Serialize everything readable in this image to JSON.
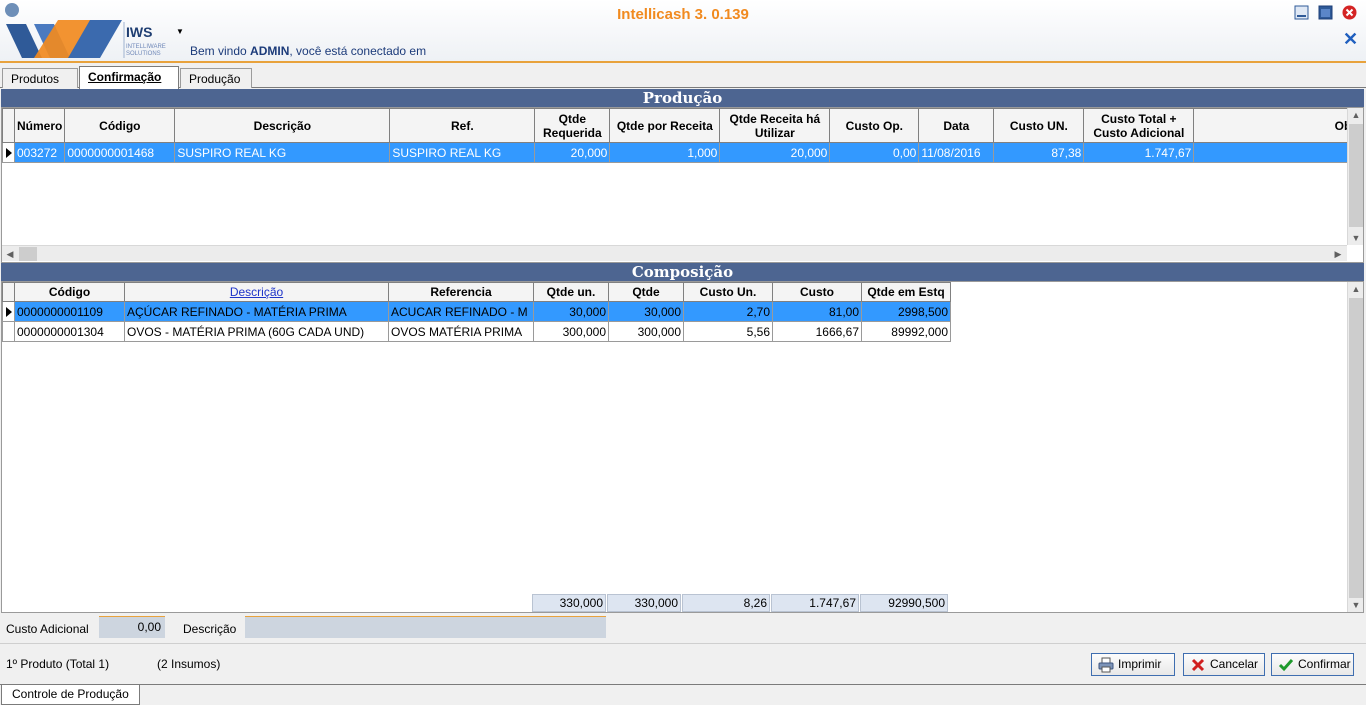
{
  "app": {
    "title": "Intellicash 3. 0.139",
    "logo_text": "IWS",
    "logo_subtitle": "INTELLIWARE SOLUTIONS",
    "welcome_prefix": "Bem vindo ",
    "welcome_user": "ADMIN",
    "welcome_suffix": ", você está conectado em"
  },
  "tabs": [
    {
      "label": "Produtos"
    },
    {
      "label": "Confirmação"
    },
    {
      "label": "Produção"
    }
  ],
  "producao": {
    "title": "Produção",
    "columns": [
      "Número",
      "Código",
      "Descrição",
      "Ref.",
      "Qtde Requerida",
      "Qtde por Receita",
      "Qtde Receita há Utilizar",
      "Custo Op.",
      "Data",
      "Custo UN.",
      "Custo Total + Custo Adicional",
      "Ob"
    ],
    "rows": [
      [
        "003272",
        "0000000001468",
        "SUSPIRO REAL KG",
        "SUSPIRO REAL KG",
        "20,000",
        "1,000",
        "20,000",
        "0,00",
        "11/08/2016",
        "87,38",
        "1.747,67",
        ""
      ]
    ]
  },
  "composicao": {
    "title": "Composição",
    "columns": [
      "Código",
      "Descrição",
      "Referencia",
      "Qtde un.",
      "Qtde",
      "Custo Un.",
      "Custo",
      "Qtde em Estq"
    ],
    "rows": [
      [
        "0000000001109",
        "AÇÚCAR REFINADO - MATÉRIA PRIMA",
        "ACUCAR REFINADO - M",
        "30,000",
        "30,000",
        "2,70",
        "81,00",
        "2998,500"
      ],
      [
        "0000000001304",
        "OVOS - MATÉRIA PRIMA (60G CADA UND)",
        "OVOS MATÉRIA PRIMA",
        "300,000",
        "300,000",
        "5,56",
        "1666,67",
        "89992,000"
      ]
    ],
    "totals": [
      "330,000",
      "330,000",
      "8,26",
      "1.747,67",
      "92990,500"
    ]
  },
  "form": {
    "custo_adicional_label": "Custo Adicional",
    "custo_adicional_value": "0,00",
    "descricao_label": "Descrição",
    "descricao_value": ""
  },
  "summary": {
    "produto": "1º Produto (Total 1)",
    "insumos": "(2 Insumos)"
  },
  "buttons": {
    "imprimir": "Imprimir",
    "cancelar": "Cancelar",
    "confirmar": "Confirmar"
  },
  "status_tab": "Controle de Produção",
  "colors": {
    "accent": "#f18a1f",
    "section_bar": "#4d6591",
    "selection": "#3399ff"
  }
}
